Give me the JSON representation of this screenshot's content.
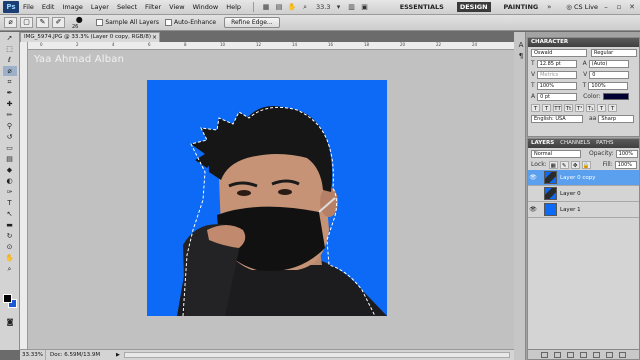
{
  "menubar": {
    "logo": "Ps",
    "items": [
      "File",
      "Edit",
      "Image",
      "Layer",
      "Select",
      "Filter",
      "View",
      "Window",
      "Help"
    ],
    "zoom": "33.3",
    "workspaces": [
      "ESSENTIALS",
      "DESIGN",
      "PAINTING"
    ],
    "active_workspace": "DESIGN",
    "cslive": "CS Live"
  },
  "options": {
    "brush_size": "26",
    "sample_all_layers": "Sample All Layers",
    "auto_enhance": "Auto-Enhance",
    "refine_edge": "Refine Edge..."
  },
  "document": {
    "tab_title": "IMG_5974.JPG @ 33.3% (Layer 0 copy, RGB/8)",
    "watermark": "Yaa Ahmad Alban",
    "ruler_ticks": [
      "0",
      "2",
      "4",
      "6",
      "8",
      "10",
      "12",
      "14",
      "16",
      "18",
      "20",
      "22",
      "24"
    ],
    "status_zoom": "33.33%",
    "status_doc": "Doc: 6.59M/13.9M"
  },
  "character": {
    "title": "CHARACTER",
    "font_family": "Oswald",
    "font_style": "Regular",
    "font_size": "12.85 pt",
    "leading": "(Auto)",
    "kerning": "Metrics",
    "tracking": "0",
    "vscale": "100%",
    "hscale": "100%",
    "baseline": "0 pt",
    "color_label": "Color:",
    "language": "English: USA",
    "aa_icon": "aa",
    "antialias": "Sharp",
    "text_color": "#000033"
  },
  "layers": {
    "tabs": [
      "LAYERS",
      "CHANNELS",
      "PATHS"
    ],
    "blend_mode": "Normal",
    "opacity_label": "Opacity:",
    "opacity": "100%",
    "lock_label": "Lock:",
    "fill_label": "Fill:",
    "fill": "100%",
    "items": [
      {
        "name": "Layer 0 copy",
        "selected": true
      },
      {
        "name": "Layer 0",
        "selected": false
      },
      {
        "name": "Layer 1",
        "selected": false
      }
    ]
  }
}
